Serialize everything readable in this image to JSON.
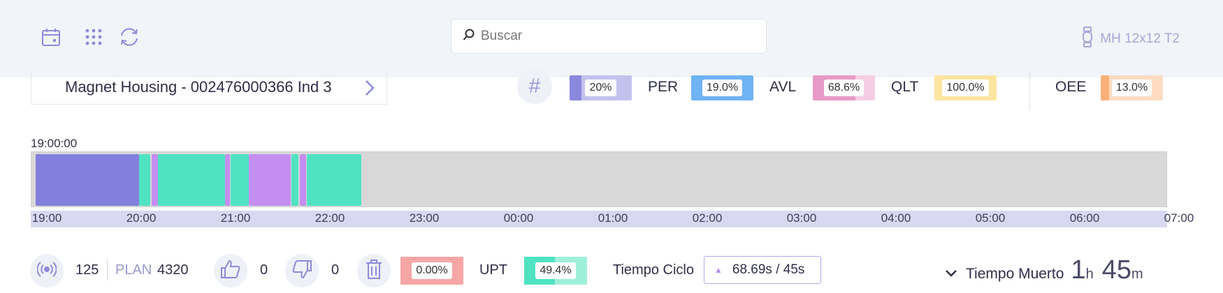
{
  "header": {
    "search_placeholder": "Buscar",
    "machine_name": "MH 12x12 T2",
    "icons": [
      "calendar-icon",
      "grid-icon",
      "refresh-icon"
    ]
  },
  "product": {
    "name": "Magnet Housing - 002476000366 Ind 3"
  },
  "metrics": {
    "first": {
      "value": "20%",
      "color": "#8a88dc"
    },
    "per": {
      "label": "PER",
      "value": "19.0%",
      "color": "#6fb3f5"
    },
    "avl": {
      "label": "AVL",
      "value": "68.6%",
      "color": "#e89ac8"
    },
    "qlt": {
      "label": "QLT",
      "value": "100.0%",
      "color": "#fde5a0"
    },
    "oee": {
      "label": "OEE",
      "value": "13.0%",
      "color": "#fbb07a"
    }
  },
  "timeline": {
    "start_label": "19:00:00",
    "ticks": [
      "19:00",
      "20:00",
      "21:00",
      "22:00",
      "23:00",
      "00:00",
      "01:00",
      "02:00",
      "03:00",
      "04:00",
      "05:00",
      "06:00",
      "07:00"
    ],
    "colors": {
      "setup": "#8280dc",
      "running": "#4fe3c2",
      "stop": "#c38ef0",
      "idle": "#d8d8d8"
    }
  },
  "bottom": {
    "count": "125",
    "plan_label": "PLAN",
    "plan_value": "4320",
    "good_count": "0",
    "bad_count": "0",
    "scrap_rate": "0.00%",
    "upt_label": "UPT",
    "upt_value": "49.4%",
    "cycle_label": "Tiempo Ciclo",
    "cycle_value": "68.69s / 45s",
    "dead_label": "Tiempo Muerto",
    "dead_hours": "1",
    "dead_h_unit": "h",
    "dead_minutes": "45",
    "dead_m_unit": "m"
  }
}
